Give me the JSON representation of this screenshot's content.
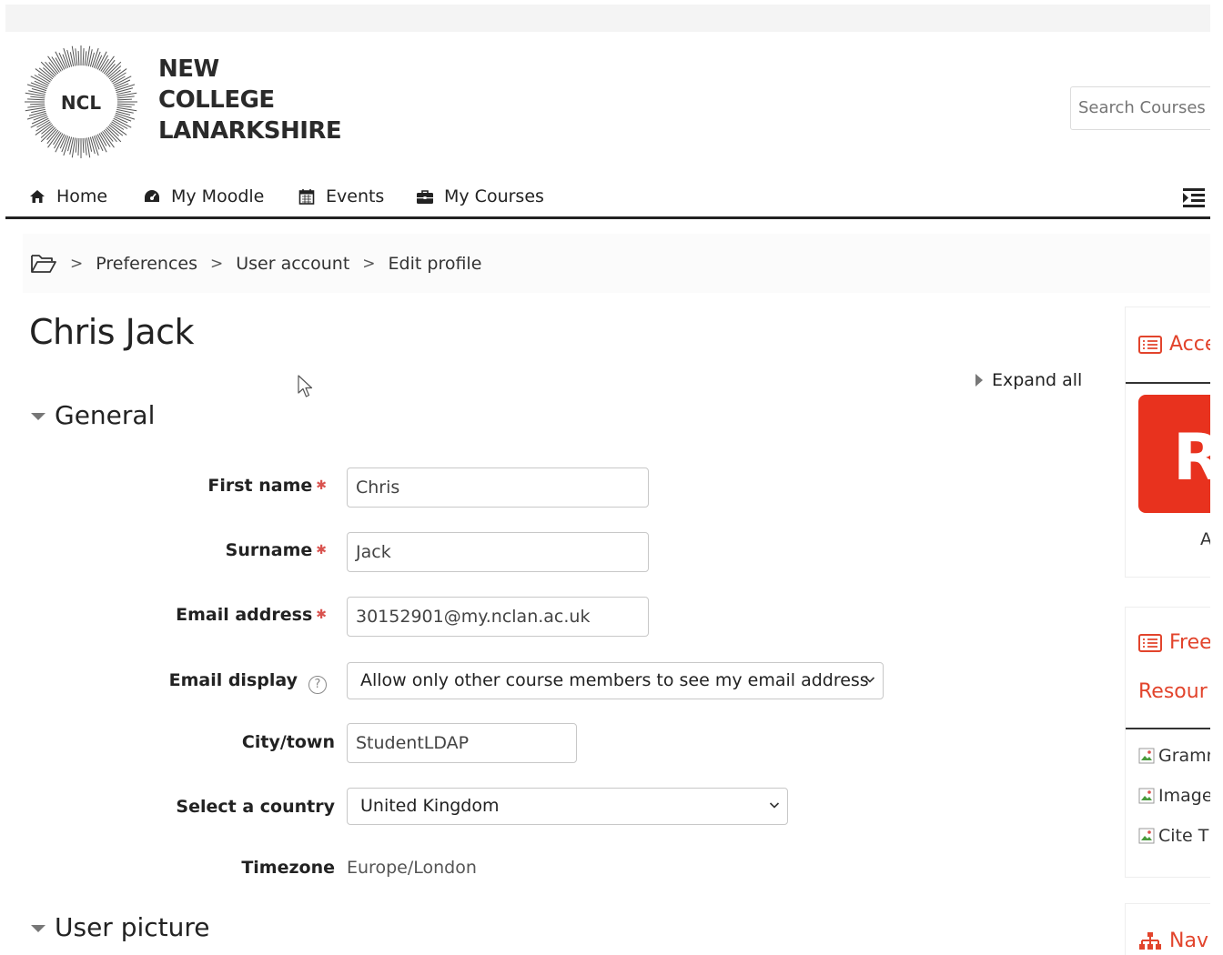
{
  "header": {
    "logo_badge": "NCL",
    "logo_lines": [
      "NEW",
      "COLLEGE",
      "LANARKSHIRE"
    ],
    "search_placeholder": "Search Courses"
  },
  "nav": {
    "items": [
      {
        "label": "Home",
        "icon": "home-icon"
      },
      {
        "label": "My Moodle",
        "icon": "dashboard-icon"
      },
      {
        "label": "Events",
        "icon": "calendar-icon"
      },
      {
        "label": "My Courses",
        "icon": "briefcase-icon"
      }
    ],
    "toggle_icon": "indent-icon"
  },
  "breadcrumb": {
    "home_icon": "folder-open-icon",
    "items": [
      "Preferences",
      "User account",
      "Edit profile"
    ]
  },
  "main": {
    "title": "Chris Jack",
    "expand_all": "Expand all",
    "sections": {
      "general": "General",
      "user_picture": "User picture"
    },
    "fields": {
      "first_name": {
        "label": "First name",
        "value": "Chris"
      },
      "surname": {
        "label": "Surname",
        "value": "Jack"
      },
      "email": {
        "label": "Email address",
        "value": "30152901@my.nclan.ac.uk"
      },
      "email_display": {
        "label": "Email display",
        "value": "Allow only other course members to see my email address"
      },
      "city": {
        "label": "City/town",
        "value": "StudentLDAP"
      },
      "country": {
        "label": "Select a country",
        "value": "United Kingdom"
      },
      "timezone": {
        "label": "Timezone",
        "value": "Europe/London"
      }
    }
  },
  "sidebar": {
    "block1": {
      "title": "Acce",
      "tile_letter": "R",
      "caption": "A"
    },
    "block2": {
      "title": "Free",
      "subtitle": "Resour",
      "images": [
        "Gramm",
        "Image",
        "Cite Th"
      ]
    },
    "block3": {
      "title": "Nav"
    }
  },
  "colors": {
    "accent": "#e2442c",
    "required": "#d9534f",
    "tile": "#e8321e"
  }
}
